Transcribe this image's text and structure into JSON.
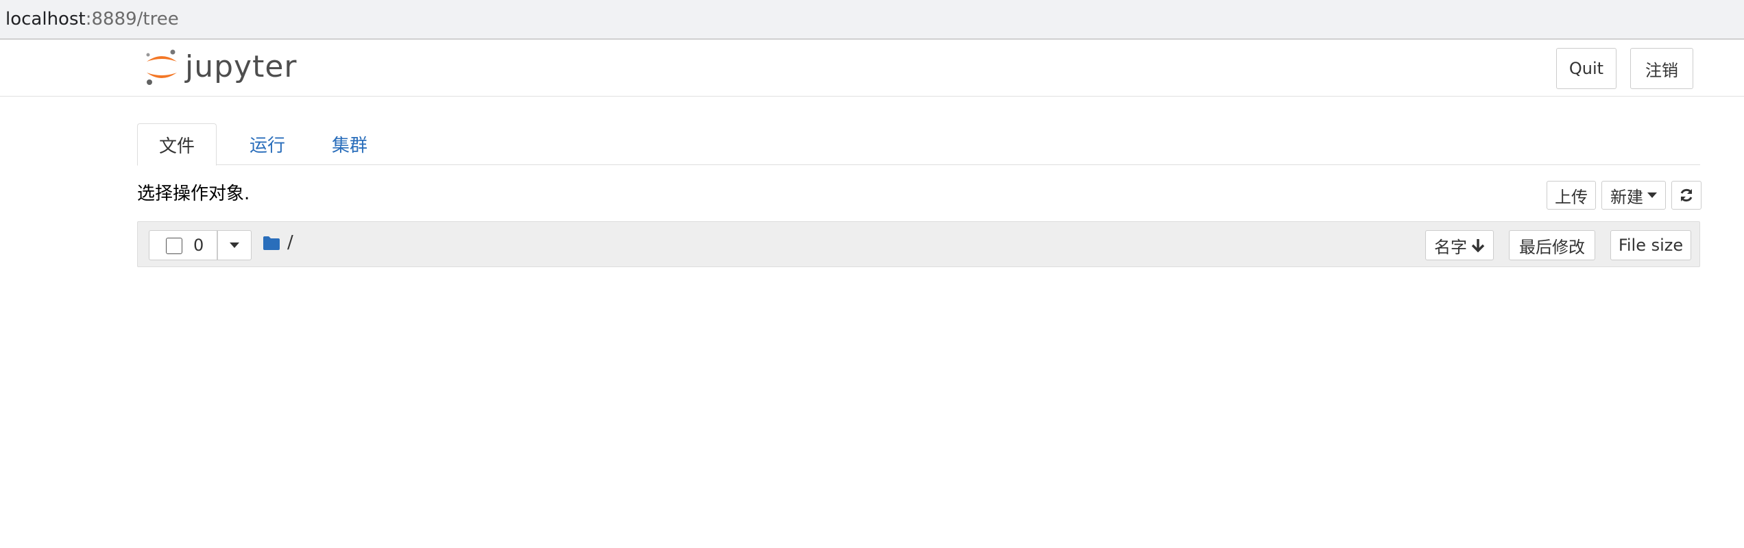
{
  "browser": {
    "url_host": "localhost",
    "url_rest": ":8889/tree"
  },
  "header": {
    "logo_text": "jupyter",
    "quit_label": "Quit",
    "logout_label": "注销"
  },
  "tabs": [
    {
      "label": "文件",
      "active": true
    },
    {
      "label": "运行",
      "active": false
    },
    {
      "label": "集群",
      "active": false
    }
  ],
  "toolbar": {
    "select_text": "选择操作对象.",
    "upload_label": "上传",
    "new_label": "新建",
    "refresh_icon": "refresh-icon"
  },
  "list_header": {
    "selected_count": "0",
    "path": "/",
    "sort_name_label": "名字",
    "sort_modified_label": "最后修改",
    "sort_size_label": "File size"
  },
  "colors": {
    "link": "#2a6ebb",
    "logo_orange": "#f37726",
    "folder": "#2a6ebb"
  }
}
